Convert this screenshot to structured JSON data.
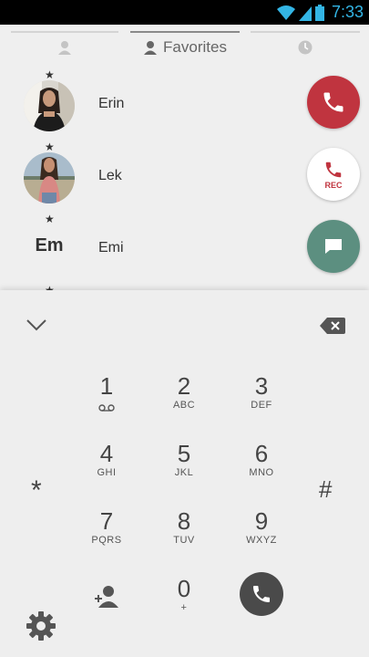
{
  "status": {
    "time": "7:33"
  },
  "tabs": [
    {
      "label": "",
      "icon": "person-icon"
    },
    {
      "label": "Favorites",
      "icon": "person-icon"
    },
    {
      "label": "",
      "icon": "clock-icon"
    }
  ],
  "favorites": [
    {
      "name": "Erin",
      "star": "★",
      "avatar": "photo",
      "action": "call"
    },
    {
      "name": "Lek",
      "star": "★",
      "avatar": "photo",
      "action": "record-call"
    },
    {
      "name": "Emi",
      "star": "★",
      "initials": "Em",
      "action": "message"
    }
  ],
  "fab": {
    "rec_label": "REC"
  },
  "colors": {
    "call_red": "#c0343f",
    "message_green": "#5c8f80",
    "clock_blue": "#33b5e5"
  },
  "dialpad": {
    "keys": [
      {
        "digit": "1",
        "letters": ""
      },
      {
        "digit": "2",
        "letters": "ABC"
      },
      {
        "digit": "3",
        "letters": "DEF"
      },
      {
        "digit": "4",
        "letters": "GHI"
      },
      {
        "digit": "5",
        "letters": "JKL"
      },
      {
        "digit": "6",
        "letters": "MNO"
      },
      {
        "digit": "7",
        "letters": "PQRS"
      },
      {
        "digit": "8",
        "letters": "TUV"
      },
      {
        "digit": "9",
        "letters": "WXYZ"
      },
      {
        "digit": "0",
        "letters": "+"
      }
    ],
    "star": "*",
    "hash": "#"
  }
}
